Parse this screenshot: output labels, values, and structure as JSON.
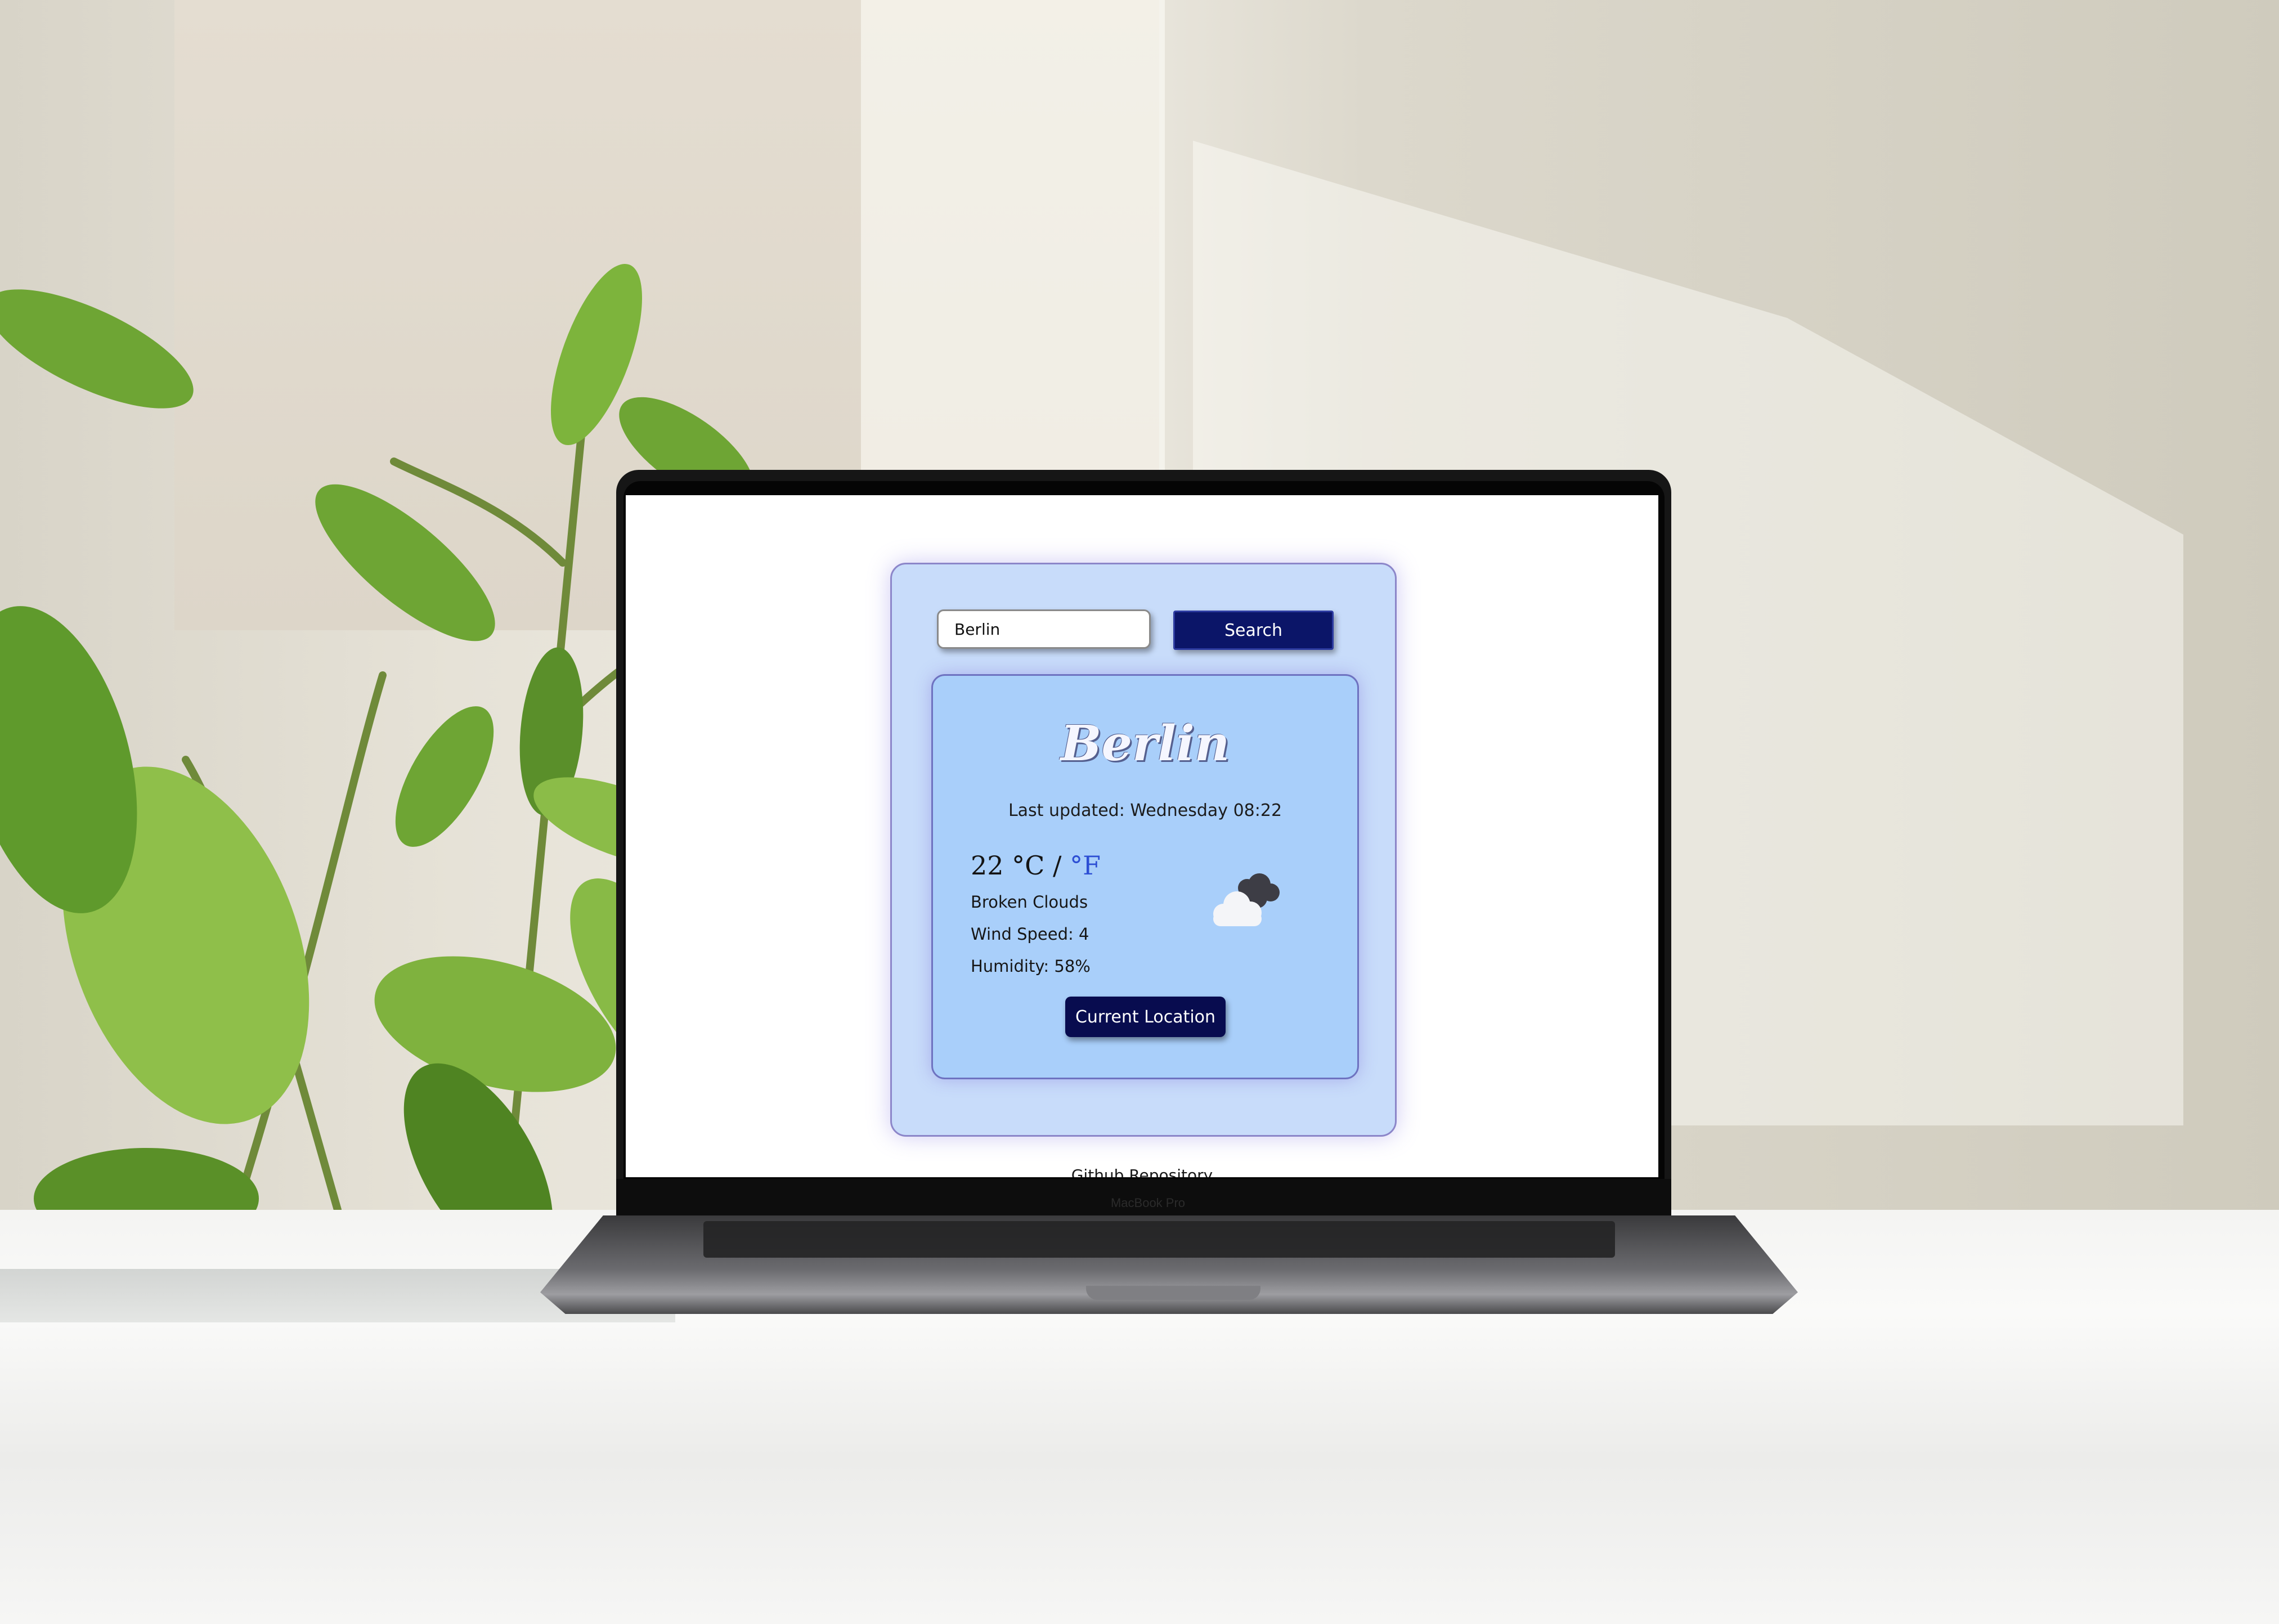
{
  "search": {
    "value": "Berlin",
    "button_label": "Search"
  },
  "weather": {
    "city": "Berlin",
    "last_updated": "Last updated: Wednesday 08:22",
    "temperature": "22",
    "unit_celsius": "°C",
    "separator": "/",
    "unit_fahrenheit": "°F",
    "description": "Broken Clouds",
    "wind": "Wind Speed: 4",
    "humidity": "Humidity: 58%",
    "icon": "broken-clouds-icon"
  },
  "actions": {
    "current_location_label": "Current Location"
  },
  "footer": {
    "link_label": "Github Repository"
  },
  "device": {
    "brand": "MacBook Pro"
  },
  "colors": {
    "outer_card": "#c8dcfa",
    "inner_card": "#a9cffa",
    "button": "#0b1568",
    "fahrenheit_link": "#2d4fd4"
  }
}
